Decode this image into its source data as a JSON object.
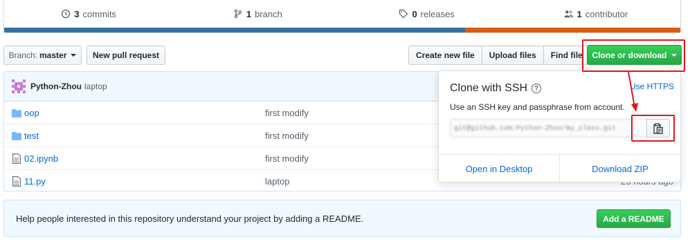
{
  "summary": {
    "commits": {
      "count": "3",
      "label": "commits",
      "icon": "history-icon"
    },
    "branches": {
      "count": "1",
      "label": "branch",
      "icon": "git-branch-icon"
    },
    "releases": {
      "count": "0",
      "label": "releases",
      "icon": "tag-icon"
    },
    "contributors": {
      "count": "1",
      "label": "contributor",
      "icon": "people-icon"
    },
    "languages": [
      {
        "color": "#3572A5",
        "share": 0.682
      },
      {
        "color": "#DA5B0B",
        "share": 0.318
      }
    ]
  },
  "toolbar": {
    "branch_prefix": "Branch:",
    "branch_value": "master",
    "new_pull_request": "New pull request",
    "create_new_file": "Create new file",
    "upload_files": "Upload files",
    "find_file": "Find file",
    "clone_or_download": "Clone or download"
  },
  "commit_tease": {
    "author": "Python-Zhou",
    "message": "laptop"
  },
  "files": [
    {
      "type": "dir",
      "name": "oop",
      "message": "first modify",
      "age": ""
    },
    {
      "type": "dir",
      "name": "test",
      "message": "first modify",
      "age": ""
    },
    {
      "type": "file",
      "name": "02.ipynb",
      "message": "first modify",
      "age": ""
    },
    {
      "type": "file",
      "name": "11.py",
      "message": "laptop",
      "age": "23 hours ago"
    }
  ],
  "readme_banner": {
    "text": "Help people interested in this repository understand your project by adding a README.",
    "button": "Add a README"
  },
  "clone_dropdown": {
    "title": "Clone with SSH",
    "use_https": "Use HTTPS",
    "description": "Use an SSH key and passphrase from account.",
    "ssh_url": "git@github.com:Python-Zhou/my_class.git",
    "open_in_desktop": "Open in Desktop",
    "download_zip": "Download ZIP"
  },
  "colors": {
    "accent_blue": "#0366d6",
    "green_button": "#28a745",
    "annotation_red": "#e3151a"
  }
}
